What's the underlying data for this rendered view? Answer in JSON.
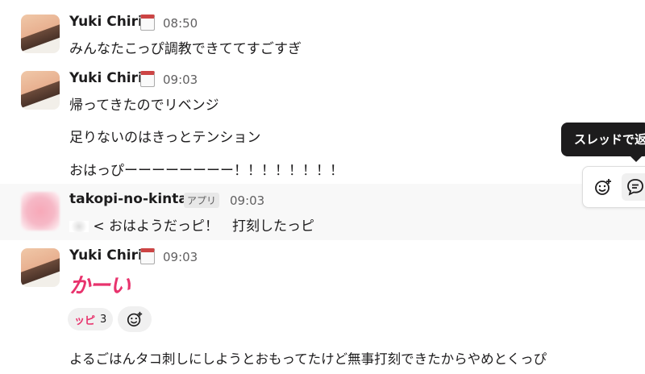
{
  "messages": [
    {
      "user": "Yuki Chiri",
      "time": "08:50",
      "lines": [
        "みんなたこっぴ調教できててすごすぎ"
      ]
    },
    {
      "user": "Yuki Chiri",
      "time": "09:03",
      "lines": [
        "帰ってきたのでリベンジ",
        "足りないのはきっとテンション",
        "おはっぴーーーーーーーー！！！！！！！！"
      ]
    },
    {
      "user": "takopi-no-kintai",
      "badge": "アプリ",
      "time": "09:03",
      "lines": [
        "< おはようだっピ！　打刻したっピ"
      ]
    },
    {
      "user": "Yuki Chiri",
      "time": "09:03",
      "sticker": "かーい",
      "reaction": {
        "emoji": "ッピ",
        "count": "3"
      },
      "lines": [
        "よるごはんタコ刺しにしようとおもってたけど無事打刻できたからやめとくっぴ"
      ]
    }
  ],
  "tooltip": "スレッドで返信する",
  "icons": {
    "calendar": "calendar-icon",
    "add_reaction": "add-reaction-icon",
    "thread": "thread-reply-icon"
  }
}
